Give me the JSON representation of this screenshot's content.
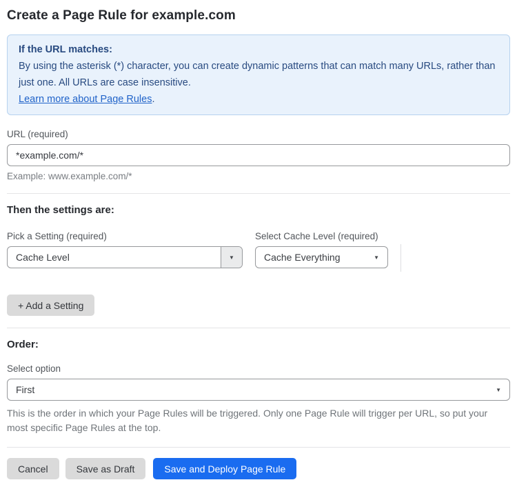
{
  "page": {
    "title": "Create a Page Rule for example.com"
  },
  "info_box": {
    "heading": "If the URL matches:",
    "body": "By using the asterisk (*) character, you can create dynamic patterns that can match many URLs, rather than just one. All URLs are case insensitive.",
    "link_label": "Learn more about Page Rules",
    "link_suffix": "."
  },
  "url_field": {
    "label": "URL (required)",
    "value": "*example.com/*",
    "helper": "Example: www.example.com/*"
  },
  "settings_section": {
    "heading": "Then the settings are:",
    "pick_setting": {
      "label": "Pick a Setting (required)",
      "selected": "Cache Level"
    },
    "cache_level": {
      "label": "Select Cache Level (required)",
      "selected": "Cache Everything"
    },
    "add_button_label": "+ Add a Setting"
  },
  "order_section": {
    "heading": "Order:",
    "label": "Select option",
    "selected": "First",
    "helper": "This is the order in which your Page Rules will be triggered. Only one Page Rule will trigger per URL, so put your most specific Page Rules at the top."
  },
  "actions": {
    "cancel_label": "Cancel",
    "save_draft_label": "Save as Draft",
    "save_deploy_label": "Save and Deploy Page Rule"
  },
  "icons": {
    "dropdown_arrow": "▼"
  },
  "colors": {
    "accent_blue": "#1a6cf0",
    "info_background": "#e9f2fc",
    "info_border": "#b6d2ef",
    "info_text": "#284a80",
    "link_blue": "#2063c9",
    "button_gray": "#dadada"
  }
}
